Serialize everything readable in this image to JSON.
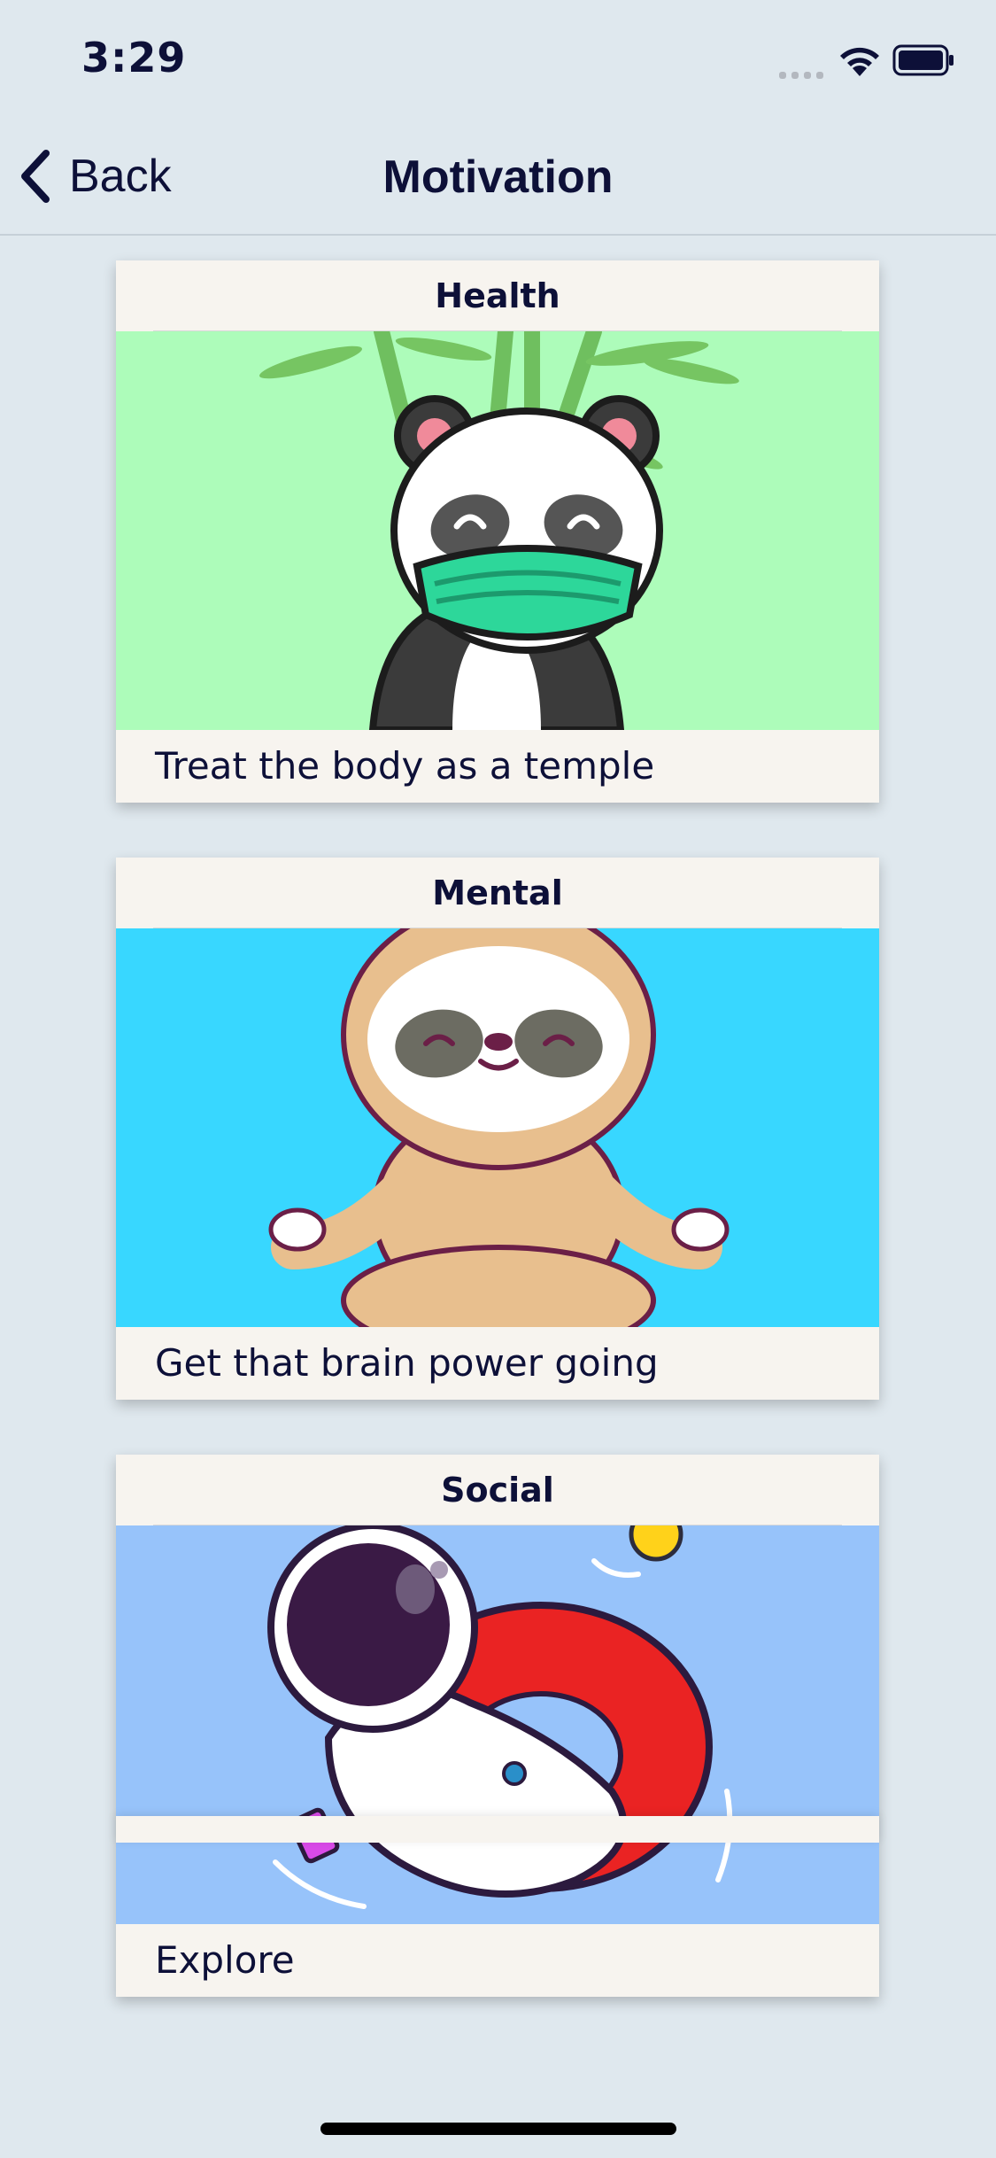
{
  "status_bar": {
    "time": "3:29"
  },
  "nav": {
    "back_label": "Back",
    "title": "Motivation"
  },
  "cards": [
    {
      "title": "Health",
      "caption": "Treat the body as a temple",
      "image": "panda-with-mask-illustration",
      "bg": "#adfcba"
    },
    {
      "title": "Mental",
      "caption": "Get that brain power going",
      "image": "meditating-sloth-illustration",
      "bg": "#38d7ff"
    },
    {
      "title": "Social",
      "caption": "Explore",
      "image": "astronaut-on-float-illustration",
      "bg": "#97c3fa"
    }
  ],
  "colors": {
    "background": "#dfe8ee",
    "card": "#f7f4ef",
    "text": "#0d1038"
  }
}
